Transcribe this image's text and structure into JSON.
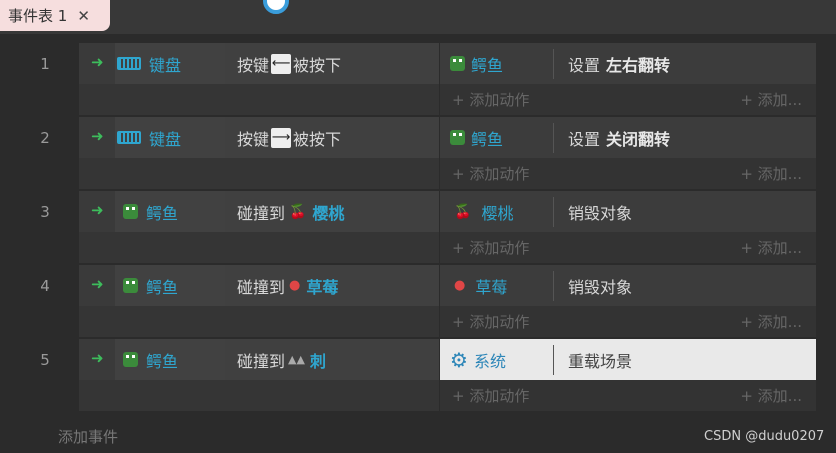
{
  "tab": {
    "title": "事件表 1",
    "close": "✕"
  },
  "rows": [
    {
      "num": "1",
      "cond_obj": "键盘",
      "cond_prefix": "按键",
      "cond_key": "⟵",
      "cond_suffix": "被按下",
      "cond_target": "",
      "act_obj": "鳄鱼",
      "act_text": "设置",
      "act_bold": "左右翻转"
    },
    {
      "num": "2",
      "cond_obj": "键盘",
      "cond_prefix": "按键",
      "cond_key": "⟶",
      "cond_suffix": "被按下",
      "cond_target": "",
      "act_obj": "鳄鱼",
      "act_text": "设置",
      "act_bold": "关闭翻转"
    },
    {
      "num": "3",
      "cond_obj": "鳄鱼",
      "cond_prefix": "碰撞到",
      "cond_key": "",
      "cond_suffix": "",
      "cond_target": "樱桃",
      "act_obj": "樱桃",
      "act_text": "销毁对象",
      "act_bold": ""
    },
    {
      "num": "4",
      "cond_obj": "鳄鱼",
      "cond_prefix": "碰撞到",
      "cond_key": "",
      "cond_suffix": "",
      "cond_target": "草莓",
      "act_obj": "草莓",
      "act_text": "销毁对象",
      "act_bold": ""
    },
    {
      "num": "5",
      "cond_obj": "鳄鱼",
      "cond_prefix": "碰撞到",
      "cond_key": "",
      "cond_suffix": "",
      "cond_target": "刺",
      "act_obj": "系统",
      "act_text": "重载场景",
      "act_bold": ""
    }
  ],
  "add_action": "+ 添加动作",
  "add_condition": "+ 添加...",
  "add_event": "添加事件",
  "watermark": "CSDN @dudu0207"
}
